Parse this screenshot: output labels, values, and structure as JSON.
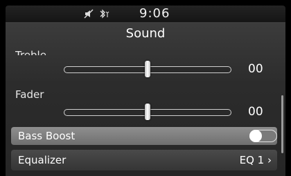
{
  "status_bar": {
    "icons": [
      "mute-icon",
      "bluetooth-icon"
    ],
    "time": "9:06"
  },
  "screen": {
    "title": "Sound"
  },
  "settings": {
    "treble": {
      "label": "Treble",
      "value": "00",
      "level": 0.5
    },
    "fader": {
      "label": "Fader",
      "value": "00",
      "level": 0.5
    },
    "bass_boost": {
      "label": "Bass Boost",
      "enabled": false
    },
    "equalizer": {
      "label": "Equalizer",
      "value": "EQ 1 ›"
    }
  },
  "colors": {
    "background": "#000000",
    "panel": "#2e2e2e",
    "highlight_row": "#808080",
    "text": "#ffffff"
  }
}
